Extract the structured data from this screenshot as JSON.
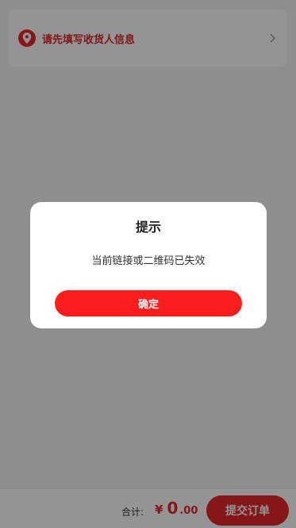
{
  "address": {
    "prompt": "请先填写收货人信息",
    "icon": "location-pin-icon",
    "arrow_icon": "chevron-right-icon"
  },
  "footer": {
    "total_label": "合计:",
    "currency": "¥",
    "amount_int": "0",
    "amount_dec": ".00",
    "submit_label": "提交订单"
  },
  "dialog": {
    "title": "提示",
    "message": "当前链接或二维码已失效",
    "confirm_label": "确定"
  },
  "colors": {
    "accent": "#e8262a",
    "confirm": "#fb1c1c",
    "overlay": "rgba(0,0,0,0.42)"
  }
}
